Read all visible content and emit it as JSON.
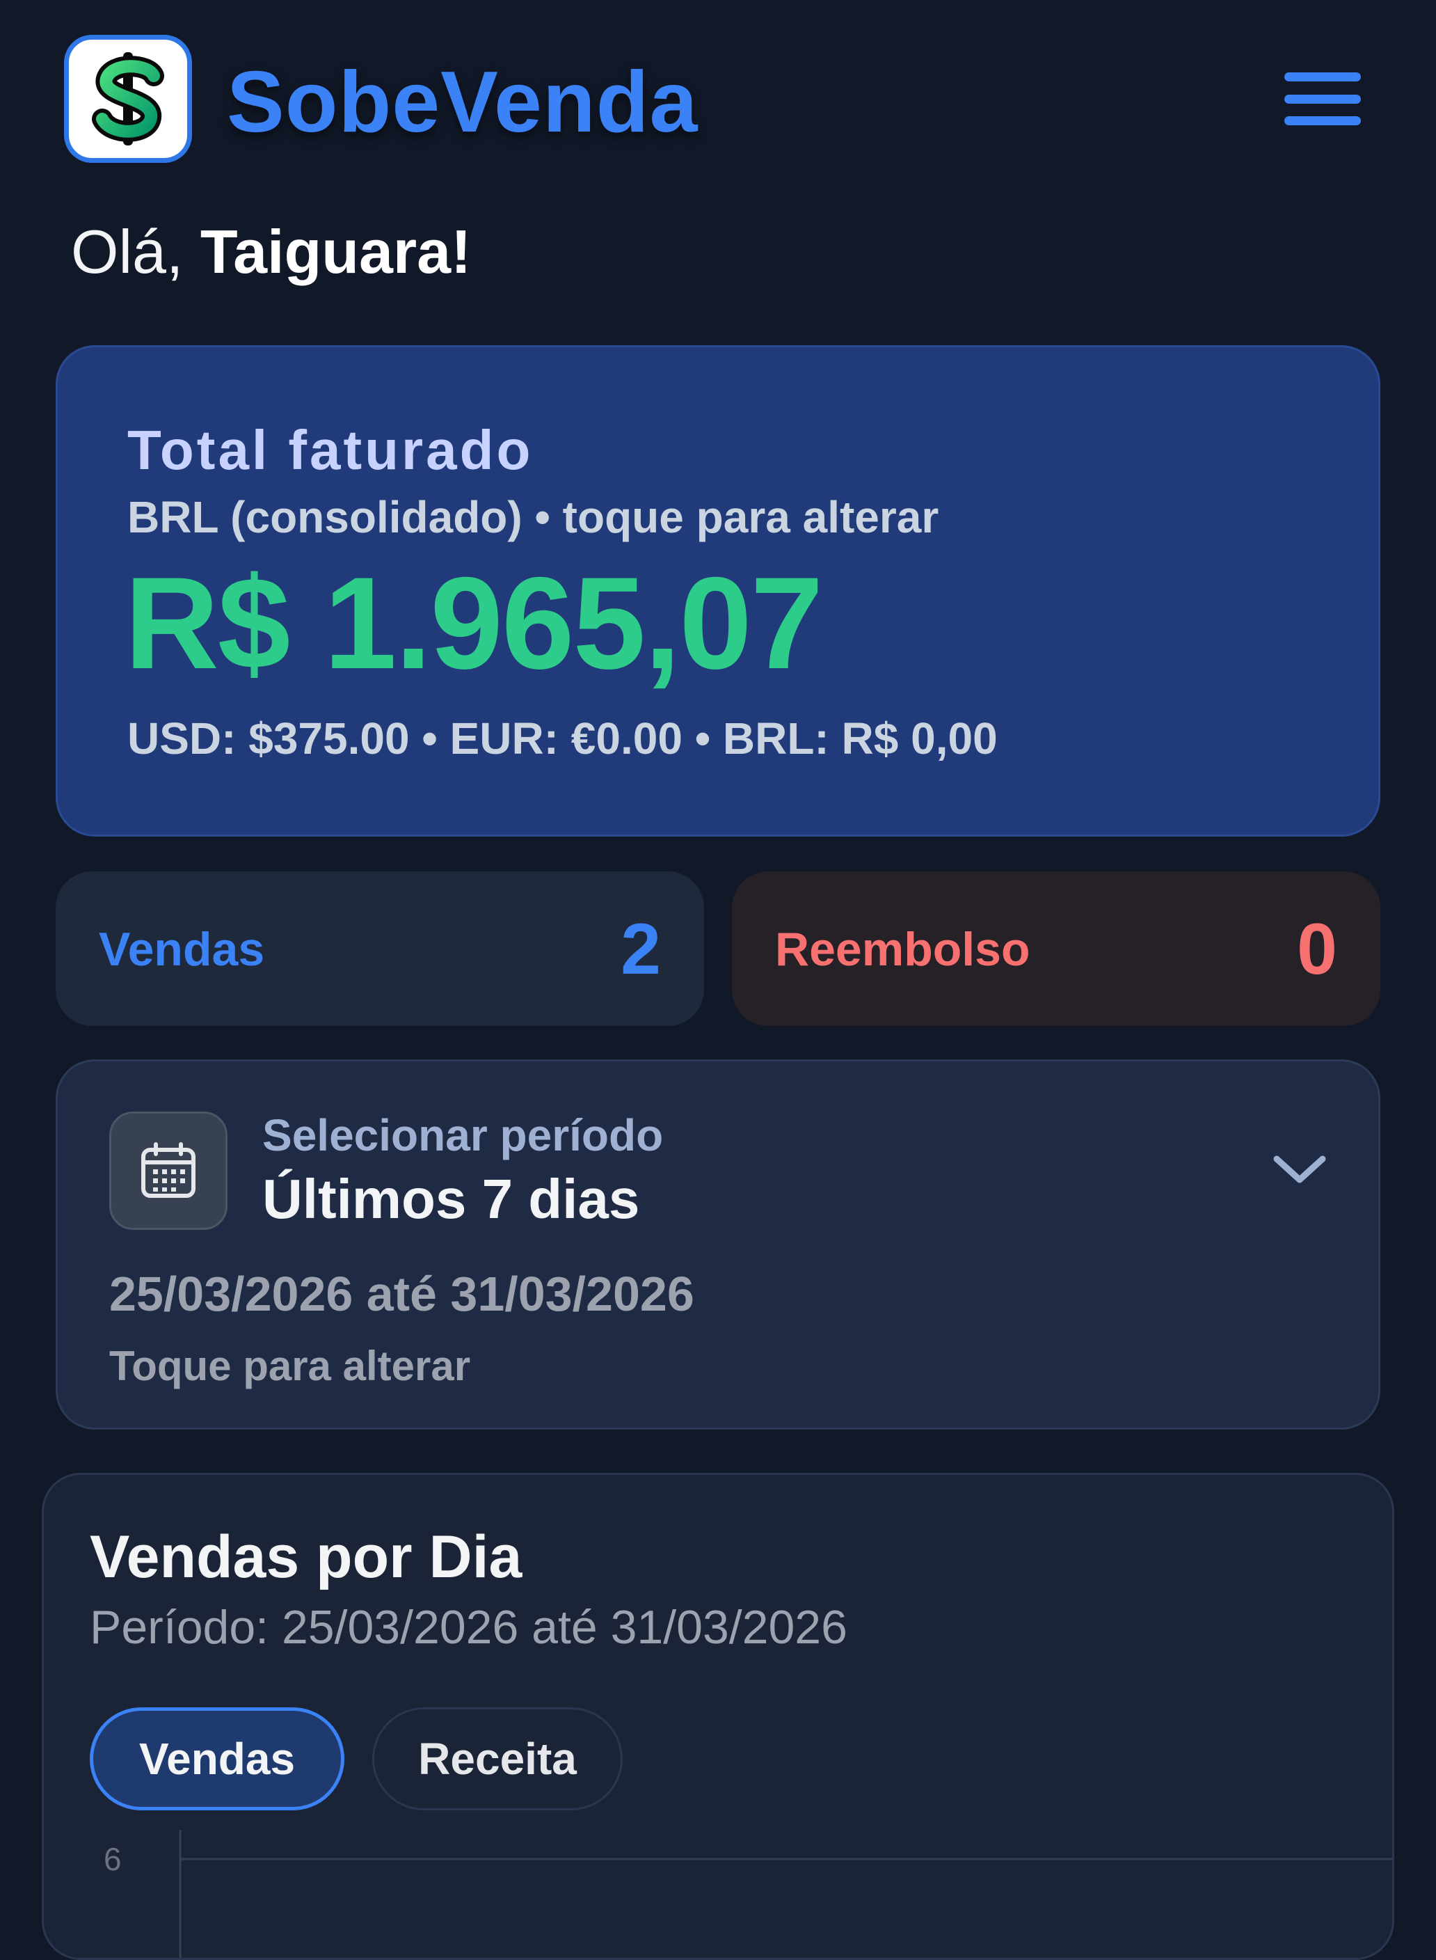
{
  "header": {
    "brand": "SobeVenda",
    "logo_icon": "dollar-sign",
    "menu_icon": "hamburger-menu"
  },
  "greeting": {
    "prefix": "Olá, ",
    "name": "Taiguara!"
  },
  "total": {
    "title": "Total faturado",
    "subtitle": "BRL (consolidado) • toque para alterar",
    "amount": "R$ 1.965,07",
    "currencies": "USD: $375.00 • EUR: €0.00 • BRL: R$ 0,00"
  },
  "stats": {
    "sales_label": "Vendas",
    "sales_count": "2",
    "refund_label": "Reembolso",
    "refund_count": "0"
  },
  "period": {
    "label": "Selecionar período",
    "value": "Últimos 7 dias",
    "range": "25/03/2026 até 31/03/2026",
    "hint": "Toque para alterar",
    "icon": "calendar-icon",
    "dropdown_icon": "chevron-down-icon"
  },
  "chart_card": {
    "title": "Vendas por Dia",
    "period": "Período: 25/03/2026 até 31/03/2026",
    "tabs": [
      "Vendas",
      "Receita"
    ],
    "active_tab": "Vendas"
  },
  "chart_data": {
    "type": "bar",
    "yticks": [
      6
    ],
    "ylim": [
      0,
      6
    ]
  },
  "colors": {
    "background": "#111827",
    "accent": "#3b82f6",
    "total_card": "#213b7a",
    "amount": "#2ecc8a",
    "refund": "#f87171"
  }
}
